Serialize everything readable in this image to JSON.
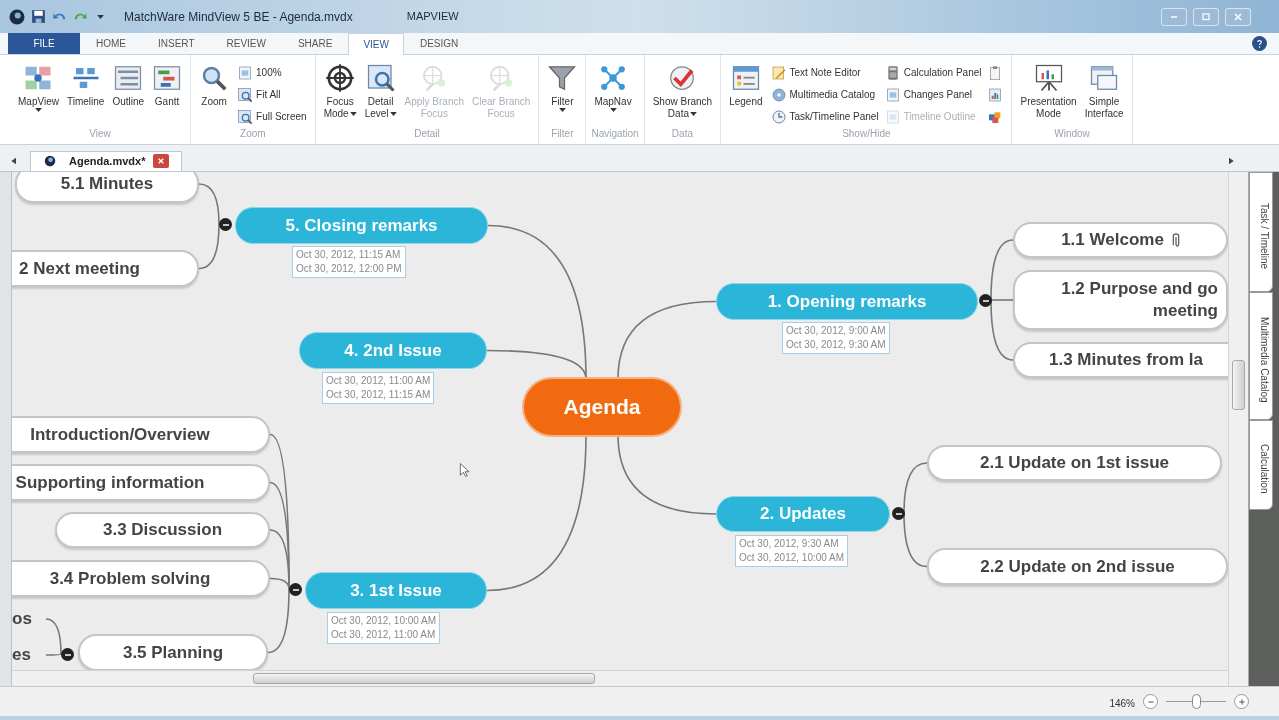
{
  "window": {
    "title": "MatchWare MindView 5 BE - Agenda.mvdx",
    "context_label": "MAPVIEW"
  },
  "ribbon_tabs": [
    {
      "label": "FILE",
      "kind": "file",
      "selected": false
    },
    {
      "label": "HOME",
      "kind": "tab",
      "selected": false
    },
    {
      "label": "INSERT",
      "kind": "tab",
      "selected": false
    },
    {
      "label": "REVIEW",
      "kind": "tab",
      "selected": false
    },
    {
      "label": "SHARE",
      "kind": "tab",
      "selected": false
    },
    {
      "label": "VIEW",
      "kind": "tab",
      "selected": true
    },
    {
      "label": "DESIGN",
      "kind": "tab",
      "selected": false
    }
  ],
  "ribbon_groups": [
    {
      "label": "View",
      "items": [
        {
          "kind": "large",
          "lines": [
            "MapView"
          ],
          "dropdown": true,
          "disabled": false
        },
        {
          "kind": "large",
          "lines": [
            "Timeline"
          ],
          "disabled": false
        },
        {
          "kind": "large",
          "lines": [
            "Outline"
          ],
          "disabled": false
        },
        {
          "kind": "large",
          "lines": [
            "Gantt"
          ],
          "disabled": false
        }
      ]
    },
    {
      "label": "Zoom",
      "items": [
        {
          "kind": "large",
          "lines": [
            "Zoom"
          ],
          "disabled": false
        },
        {
          "kind": "small",
          "lines": [
            "100%"
          ],
          "disabled": false
        },
        {
          "kind": "small",
          "lines": [
            "Fit All"
          ],
          "disabled": false
        },
        {
          "kind": "small",
          "lines": [
            "Full Screen"
          ],
          "disabled": false
        }
      ]
    },
    {
      "label": "Detail",
      "items": [
        {
          "kind": "large",
          "lines": [
            "Focus",
            "Mode"
          ],
          "dropdown": true,
          "disabled": false
        },
        {
          "kind": "large",
          "lines": [
            "Detail",
            "Level"
          ],
          "dropdown": true,
          "disabled": false
        },
        {
          "kind": "large",
          "lines": [
            "Apply Branch",
            "Focus"
          ],
          "disabled": true
        },
        {
          "kind": "large",
          "lines": [
            "Clear Branch",
            "Focus"
          ],
          "disabled": true
        }
      ]
    },
    {
      "label": "Filter",
      "items": [
        {
          "kind": "large",
          "lines": [
            "Filter"
          ],
          "dropdown": true,
          "disabled": false
        }
      ]
    },
    {
      "label": "Navigation",
      "items": [
        {
          "kind": "large",
          "lines": [
            "MapNav"
          ],
          "dropdown": true,
          "disabled": false
        }
      ]
    },
    {
      "label": "Data",
      "items": [
        {
          "kind": "large",
          "lines": [
            "Show Branch",
            "Data"
          ],
          "dropdown": true,
          "disabled": false
        }
      ]
    },
    {
      "label": "Show/Hide",
      "items": [
        {
          "kind": "large",
          "lines": [
            "Legend"
          ],
          "disabled": false
        },
        {
          "kind": "small",
          "lines": [
            "Text Note Editor"
          ],
          "disabled": false
        },
        {
          "kind": "small",
          "lines": [
            "Multimedia Catalog"
          ],
          "disabled": false
        },
        {
          "kind": "small",
          "lines": [
            "Task/Timeline Panel"
          ],
          "disabled": false
        },
        {
          "kind": "small",
          "lines": [
            "Calculation Panel"
          ],
          "disabled": false
        },
        {
          "kind": "small",
          "lines": [
            "Changes Panel"
          ],
          "disabled": false
        },
        {
          "kind": "small",
          "lines": [
            "Timeline Outline"
          ],
          "disabled": true
        },
        {
          "kind": "icon",
          "disabled": false
        },
        {
          "kind": "icon",
          "disabled": false
        },
        {
          "kind": "icon",
          "disabled": false
        }
      ]
    },
    {
      "label": "Window",
      "items": [
        {
          "kind": "large",
          "lines": [
            "Presentation",
            "Mode"
          ],
          "disabled": false
        },
        {
          "kind": "large",
          "lines": [
            "Simple",
            "Interface"
          ],
          "disabled": false
        }
      ]
    }
  ],
  "document_tabs": [
    {
      "label": "Agenda.mvdx*",
      "selected": true
    }
  ],
  "mind_map": {
    "root": {
      "kind": "central",
      "lines": [
        "Agenda"
      ],
      "children": [
        {
          "kind": "main",
          "lines": [
            "5.  Closing remarks"
          ],
          "dates": [
            "Oct 30, 2012, 11:15 AM",
            "Oct 30, 2012, 12:00 PM"
          ],
          "expanded": true,
          "children": [
            {
              "kind": "sub",
              "lines": [
                "5.1  Minutes"
              ]
            },
            {
              "kind": "sub",
              "lines": [
                "2  Next meeting"
              ]
            }
          ]
        },
        {
          "kind": "main",
          "lines": [
            "1.  Opening remarks"
          ],
          "dates": [
            "Oct 30, 2012, 9:00 AM",
            "Oct 30, 2012, 9:30 AM"
          ],
          "expanded": true,
          "children": [
            {
              "kind": "sub",
              "lines": [
                "1.1  Welcome"
              ],
              "attachment": true
            },
            {
              "kind": "sub",
              "lines": [
                "1.2  Purpose and go",
                "meeting"
              ]
            },
            {
              "kind": "sub",
              "lines": [
                "1.3  Minutes from la"
              ]
            }
          ]
        },
        {
          "kind": "main",
          "lines": [
            "4.  2nd Issue"
          ],
          "dates": [
            "Oct 30, 2012, 11:00 AM",
            "Oct 30, 2012, 11:15 AM"
          ]
        },
        {
          "kind": "main",
          "lines": [
            "2.  Updates"
          ],
          "dates": [
            "Oct 30, 2012, 9:30 AM",
            "Oct 30, 2012, 10:00 AM"
          ],
          "expanded": true,
          "children": [
            {
              "kind": "sub",
              "lines": [
                "2.1  Update on 1st issue"
              ]
            },
            {
              "kind": "sub",
              "lines": [
                "2.2  Update on 2nd issue"
              ]
            }
          ]
        },
        {
          "kind": "main",
          "lines": [
            "3.  1st Issue"
          ],
          "dates": [
            "Oct 30, 2012, 10:00 AM",
            "Oct 30, 2012, 11:00 AM"
          ],
          "expanded": true,
          "children": [
            {
              "kind": "sub",
              "lines": [
                "Introduction/Overview"
              ]
            },
            {
              "kind": "sub",
              "lines": [
                "Supporting information"
              ]
            },
            {
              "kind": "sub",
              "lines": [
                "3.3  Discussion"
              ]
            },
            {
              "kind": "sub",
              "lines": [
                "3.4  Problem solving"
              ]
            },
            {
              "kind": "sub",
              "lines": [
                "3.5  Planning"
              ],
              "expanded": true,
              "children": [
                {
                  "kind": "fragment",
                  "lines": [
                    "os"
                  ]
                },
                {
                  "kind": "fragment",
                  "lines": [
                    "es"
                  ]
                }
              ]
            }
          ]
        }
      ]
    }
  },
  "side_tabs": [
    {
      "label": "Task / Timeline"
    },
    {
      "label": "Multimedia Catalog"
    },
    {
      "label": "Calculation"
    }
  ],
  "status_bar": {
    "zoom": "146%",
    "zoom_slider": {
      "level": 0.5
    }
  }
}
